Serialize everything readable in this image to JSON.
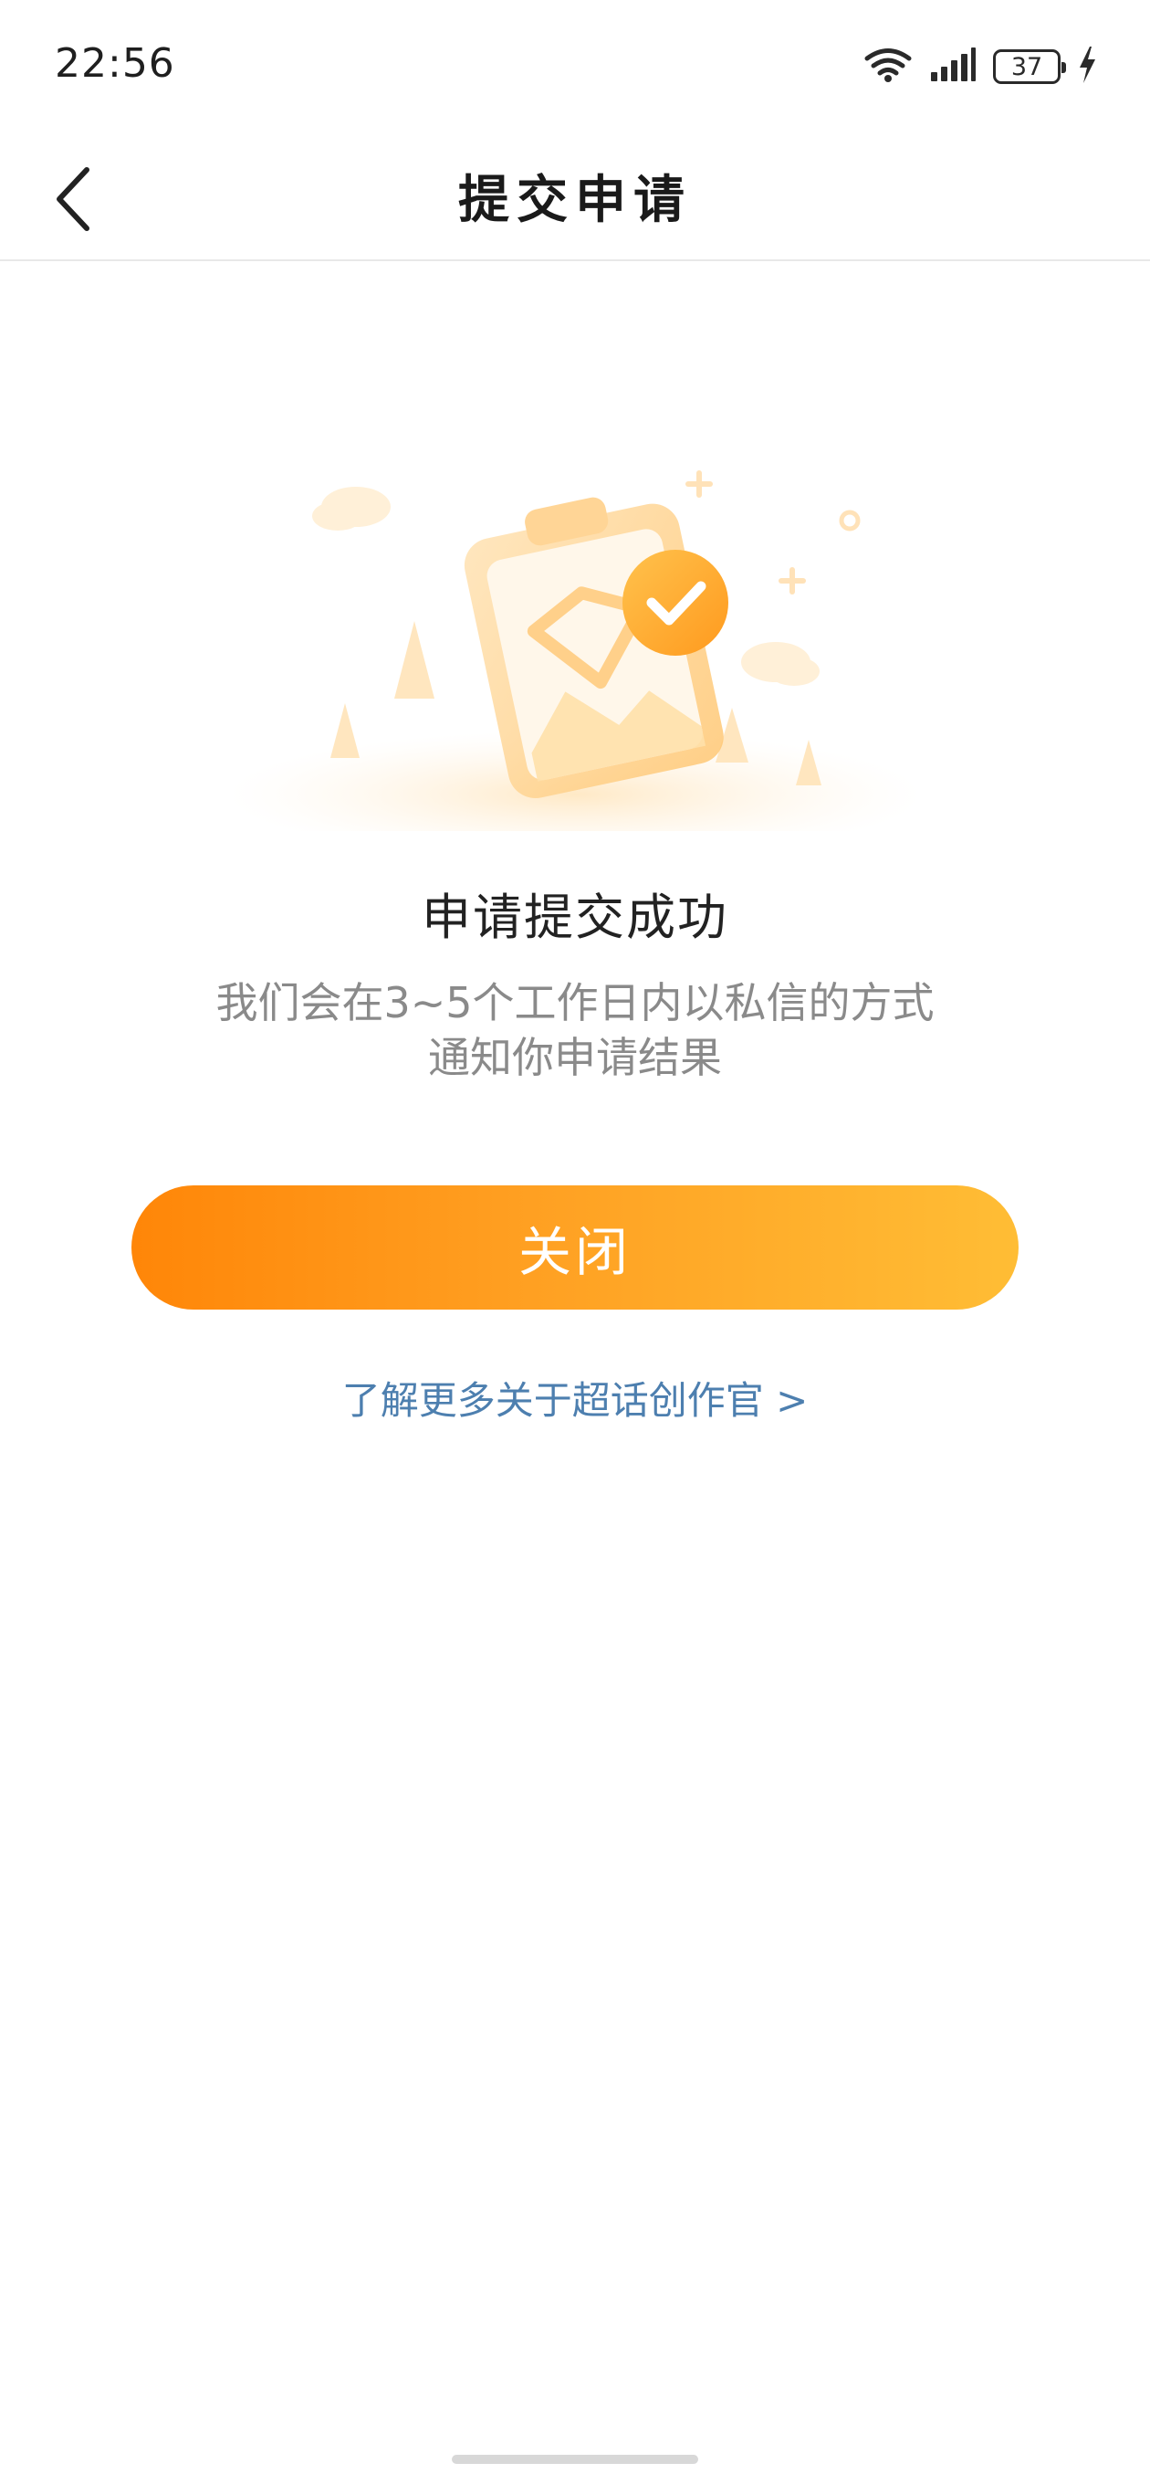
{
  "status_bar": {
    "time": "22:56",
    "battery_level": "37",
    "icons": [
      "wifi-icon",
      "signal-icon",
      "battery-icon",
      "charging-icon"
    ]
  },
  "nav": {
    "title": "提交申请",
    "back_icon": "chevron-left-icon"
  },
  "result": {
    "title": "申请提交成功",
    "description_line1": "我们会在3~5个工作日内以私信的方式",
    "description_line2": "通知你申请结果",
    "illustration_icon": "success-clipboard-check-icon"
  },
  "actions": {
    "close_label": "关闭",
    "learn_more_label": "了解更多关于超话创作官 >"
  },
  "colors": {
    "accent_start": "#ff8608",
    "accent_end": "#ffbd35",
    "link": "#4d7faf",
    "secondary_text": "#8a8a8a"
  }
}
